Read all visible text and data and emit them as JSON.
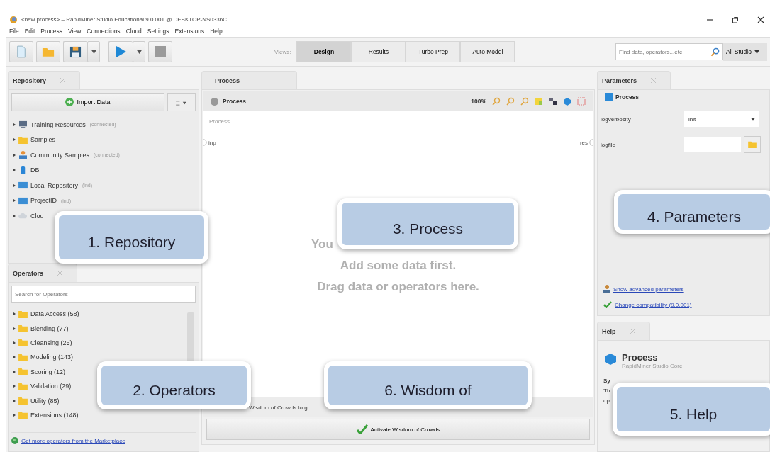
{
  "window": {
    "title": "<new process> – RapidMiner Studio Educational 9.0.001 @ DESKTOP-NS0336C"
  },
  "menu": [
    "File",
    "Edit",
    "Process",
    "View",
    "Connections",
    "Cloud",
    "Settings",
    "Extensions",
    "Help"
  ],
  "toolbar": {
    "views_label": "Views:",
    "views": [
      {
        "label": "Design",
        "selected": true
      },
      {
        "label": "Results",
        "selected": false
      },
      {
        "label": "Turbo Prep",
        "selected": false
      },
      {
        "label": "Auto Model",
        "selected": false
      }
    ],
    "search": {
      "placeholder": "Find data, operators...etc"
    },
    "scope": "All Studio"
  },
  "repository": {
    "tab": "Repository",
    "import_button": "Import Data",
    "items": [
      {
        "kind": "server",
        "name": "Training Resources",
        "note": "(connected)"
      },
      {
        "kind": "folder",
        "name": "Samples"
      },
      {
        "kind": "people",
        "name": "Community Samples",
        "note": "(connected)"
      },
      {
        "kind": "database",
        "name": "DB"
      },
      {
        "kind": "repo",
        "name": "Local Repository",
        "note": "(ind)"
      },
      {
        "kind": "repo",
        "name": "ProjectID",
        "note": "(ind)"
      },
      {
        "kind": "cloud",
        "name": "Clou"
      }
    ]
  },
  "operators": {
    "tab": "Operators",
    "search": {
      "placeholder": "Search for Operators"
    },
    "items": [
      {
        "name": "Data Access (58)"
      },
      {
        "name": "Blending (77)"
      },
      {
        "name": "Cleansing (25)"
      },
      {
        "name": "Modeling (143)"
      },
      {
        "name": "Scoring (12)"
      },
      {
        "name": "Validation (29)"
      },
      {
        "name": "Utility (85)"
      },
      {
        "name": "Extensions (148)"
      }
    ],
    "footer_link": "Get more operators from the Marketplace"
  },
  "process": {
    "tab": "Process",
    "breadcrumb": "Process",
    "zoom": "100%",
    "canvas_label": "Process",
    "input_port": "inp",
    "output_port": "res",
    "hints": [
      "You",
      "Add some data first.",
      "Drag data or operators here."
    ],
    "wisdom_text": "Wisdom of Crowds to g",
    "wisdom_button": "Activate Wisdom of Crowds"
  },
  "parameters": {
    "tab": "Parameters",
    "operator": "Process",
    "params": [
      {
        "kind": "select",
        "label": "logverbosity",
        "value": "init"
      },
      {
        "kind": "file",
        "label": "logfile"
      }
    ],
    "links": [
      {
        "kind": "advanced",
        "text": "Show advanced parameters"
      },
      {
        "kind": "compat",
        "text": "Change compatibility (9.0.001)"
      }
    ]
  },
  "help": {
    "tab": "Help",
    "title": "Process",
    "subtitle": "RapidMiner Studio Core",
    "fragments": [
      "Sy",
      "Th",
      "op"
    ]
  },
  "callouts": [
    "1. Repository",
    "2. Operators",
    "3. Process",
    "4. Parameters",
    "5. Help",
    "6. Wisdom of"
  ]
}
